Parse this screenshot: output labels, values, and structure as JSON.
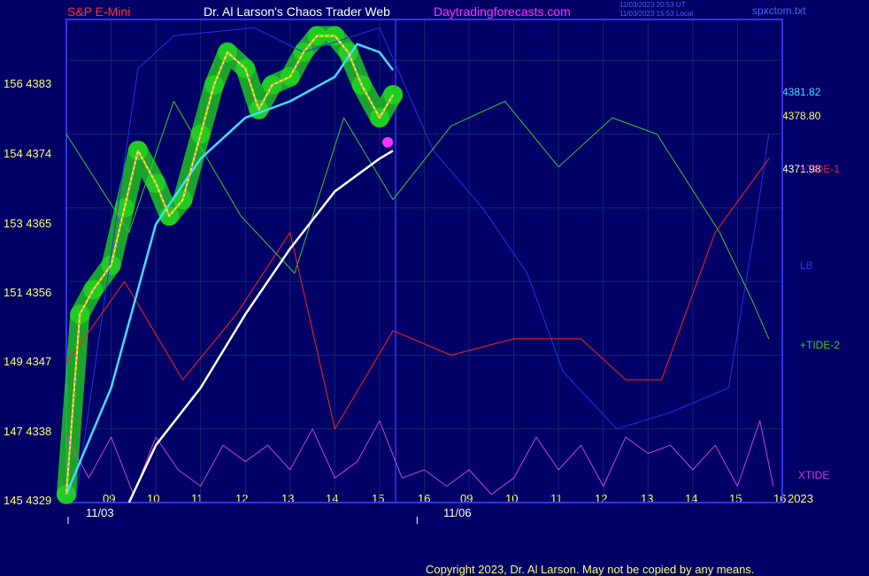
{
  "header": {
    "symbol": "S&P E-Mini",
    "author": "Dr. Al Larson's Chaos Trader Web",
    "site": "Daytradingforecasts.com",
    "stamp1": "11/03/2023 20:53 UT",
    "stamp2": "11/03/2023 15:53 Local",
    "file": "spxctom.txt"
  },
  "colors": {
    "background": "#000066",
    "frame": "#3333ff",
    "price": "#ffff00",
    "avg_fast": "#44ddff",
    "avg_slow": "#ffffff",
    "tide1": "#ff2222",
    "tide2": "#33cc33",
    "xtide": "#cc44cc",
    "lb": "#2233ee",
    "ball": "#22ee22"
  },
  "y_axis": {
    "labels": [
      {
        "text": "156  4383",
        "value": 4383
      },
      {
        "text": "154  4374",
        "value": 4374
      },
      {
        "text": "153  4365",
        "value": 4365
      },
      {
        "text": "151  4356",
        "value": 4356
      },
      {
        "text": "149  4347",
        "value": 4347
      },
      {
        "text": "147  4338",
        "value": 4338
      },
      {
        "text": "145  4329",
        "value": 4329
      }
    ]
  },
  "x_axis": {
    "hours": [
      "09",
      "10",
      "11",
      "12",
      "13",
      "14",
      "15",
      "16",
      "09",
      "10",
      "11",
      "12",
      "13",
      "14",
      "15",
      "16"
    ],
    "dates": [
      "11/03",
      "11/06"
    ],
    "year": "2023"
  },
  "right_labels": {
    "avg_fast": "4381.82",
    "price_last": "4378.80",
    "avg_slow": "4371.98",
    "tide1": "+TIDE-1",
    "lb": "LB",
    "tide2": "+TIDE-2",
    "xtide": "XTIDE"
  },
  "copyright": "Copyright 2023, Dr. Al Larson. May not be copied by any means.",
  "chart_data": {
    "type": "line",
    "title": "S&P E-Mini",
    "ylim": [
      4329,
      4388
    ],
    "x_range_hours": [
      0,
      16
    ],
    "series": [
      {
        "name": "price",
        "x": [
          0,
          0.3,
          0.6,
          1,
          1.3,
          1.6,
          2,
          2.3,
          2.6,
          3,
          3.3,
          3.6,
          4,
          4.3,
          4.6,
          5,
          5.3,
          5.6,
          6,
          6.3,
          6.6,
          7,
          7.3
        ],
        "values": [
          4330,
          4352,
          4355,
          4358,
          4365,
          4372,
          4368,
          4364,
          4366,
          4374,
          4380,
          4384,
          4382,
          4377,
          4380,
          4381,
          4384,
          4386,
          4386,
          4384,
          4380,
          4376,
          4378.8
        ]
      },
      {
        "name": "avg_fast",
        "x": [
          0,
          1,
          2,
          3,
          4,
          5,
          6,
          6.5,
          7,
          7.3
        ],
        "values": [
          4330,
          4343,
          4363,
          4371,
          4376,
          4378,
          4381,
          4385,
          4384,
          4381.82
        ]
      },
      {
        "name": "avg_slow",
        "x": [
          1.4,
          2,
          3,
          4,
          5,
          6,
          7,
          7.3
        ],
        "values": [
          4329,
          4336,
          4343,
          4352,
          4360,
          4367,
          4371,
          4371.98
        ]
      },
      {
        "name": "+TIDE-1",
        "x": [
          0,
          1.3,
          2.6,
          3.8,
          5,
          6,
          7.3,
          8.6,
          10,
          11.5,
          12.5,
          13.3,
          14.5,
          15.7
        ],
        "values": [
          4346,
          4356,
          4344,
          4352,
          4362,
          4338,
          4350,
          4347,
          4349,
          4349,
          4344,
          4344,
          4362,
          4371
        ]
      },
      {
        "name": "+TIDE-2",
        "x": [
          0,
          1.4,
          2.4,
          3.9,
          5.1,
          6.2,
          7.3,
          8.6,
          9.8,
          11,
          12.2,
          13.2,
          14.6,
          15.3,
          15.7
        ],
        "values": [
          4374,
          4362,
          4378,
          4364,
          4357,
          4376,
          4366,
          4375,
          4378,
          4370,
          4376,
          4374,
          4362,
          4354,
          4349
        ]
      },
      {
        "name": "LB",
        "x": [
          0.2,
          1.6,
          2.4,
          4.2,
          5.3,
          7,
          8.2,
          9.3,
          10.3,
          11.1,
          12.3,
          13.5,
          14.8,
          15.4,
          15.7
        ],
        "values": [
          4329,
          4382,
          4386,
          4387,
          4384,
          4387,
          4372,
          4365,
          4357,
          4345,
          4338,
          4340,
          4343,
          4363,
          4374
        ]
      },
      {
        "name": "XTIDE",
        "x": [
          0,
          0.5,
          1,
          1.5,
          2,
          2.5,
          3,
          3.5,
          4,
          4.5,
          5,
          5.5,
          6,
          6.5,
          7,
          7.5,
          8,
          8.5,
          9,
          9.5,
          10,
          10.5,
          11,
          11.5,
          12,
          12.5,
          13,
          13.5,
          14,
          14.5,
          15,
          15.5,
          15.8
        ],
        "values": [
          4337,
          4332,
          4337,
          4330,
          4337,
          4333,
          4331,
          4336,
          4334,
          4336,
          4333,
          4338,
          4332,
          4334,
          4339,
          4332,
          4333,
          4331,
          4333,
          4330,
          4332,
          4337,
          4333,
          4336,
          4331,
          4337,
          4335,
          4336,
          4333,
          4336,
          4331,
          4339,
          4331
        ]
      }
    ]
  }
}
